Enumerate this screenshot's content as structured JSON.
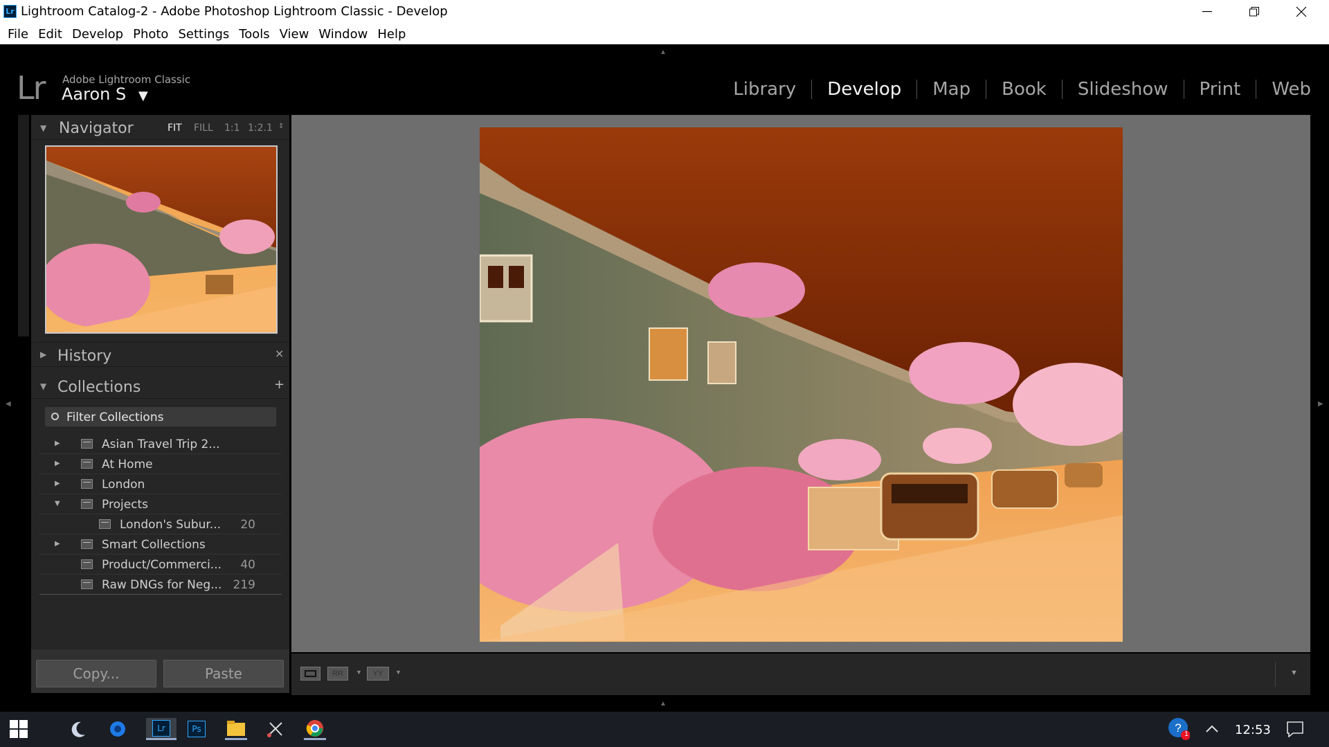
{
  "window": {
    "app_icon": "Lr",
    "title": "Lightroom Catalog-2 - Adobe Photoshop Lightroom Classic - Develop",
    "controls": [
      "minimize-icon",
      "restore-icon",
      "close-icon"
    ]
  },
  "menu": [
    "File",
    "Edit",
    "Develop",
    "Photo",
    "Settings",
    "Tools",
    "View",
    "Window",
    "Help"
  ],
  "identity": {
    "logo": "Lr",
    "product": "Adobe Lightroom Classic",
    "user": "Aaron S",
    "user_caret": "▼"
  },
  "modules": [
    {
      "label": "Library",
      "active": false
    },
    {
      "label": "Develop",
      "active": true
    },
    {
      "label": "Map",
      "active": false
    },
    {
      "label": "Book",
      "active": false
    },
    {
      "label": "Slideshow",
      "active": false
    },
    {
      "label": "Print",
      "active": false
    },
    {
      "label": "Web",
      "active": false
    }
  ],
  "navigator": {
    "title": "Navigator",
    "zoom_options": [
      "FIT",
      "FILL",
      "1:1",
      "1:2.1"
    ],
    "active_zoom": "FIT"
  },
  "history": {
    "title": "History",
    "close_glyph": "×"
  },
  "collections": {
    "title": "Collections",
    "add_glyph": "+",
    "filter_placeholder": "Filter Collections",
    "items": [
      {
        "label": "Asian Travel Trip 2...",
        "count": "",
        "expander": "right"
      },
      {
        "label": "At Home",
        "count": "",
        "expander": "right"
      },
      {
        "label": "London",
        "count": "",
        "expander": "right"
      },
      {
        "label": "Projects",
        "count": "",
        "expander": "down"
      },
      {
        "label": "London's Subur...",
        "count": "20",
        "expander": "none",
        "indent": true
      },
      {
        "label": "Smart Collections",
        "count": "",
        "expander": "right"
      },
      {
        "label": "Product/Commerci...",
        "count": "40",
        "expander": "none"
      },
      {
        "label": "Raw DNGs for Neg...",
        "count": "219",
        "expander": "none"
      }
    ]
  },
  "actions": {
    "copy": "Copy...",
    "paste": "Paste"
  },
  "toolbar": {
    "view_loupe": "loupe-view-icon",
    "view_compare": "RR",
    "view_survey": "YY"
  },
  "taskbar": {
    "clock": "12:53",
    "notification_badge": "1",
    "icons": [
      "windows-start-icon",
      "moon-icon",
      "circle-blue-icon",
      "lightroom-icon",
      "photoshop-icon",
      "file-explorer-icon",
      "scissor-icon",
      "chrome-icon"
    ]
  },
  "colors": {
    "accent_bg": "#262626",
    "photo_sky": "#7a2a05",
    "photo_street": "#f2a050"
  }
}
